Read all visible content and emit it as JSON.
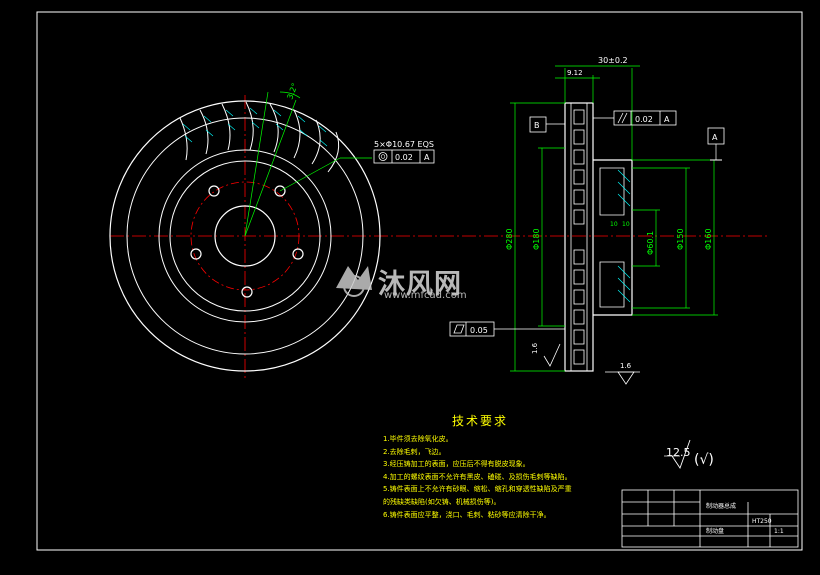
{
  "drawing": {
    "background": "#000000",
    "line_color": "#ffffff",
    "center_line_color": "#ff0000",
    "dim_color": "#00ff00",
    "text_color": "#ffff00"
  },
  "front_view": {
    "angle_label": "3.2°",
    "hole_callout": "5×Φ10.67 EQS",
    "position_tol": "0.02",
    "datum": "A"
  },
  "section_view": {
    "top_dim": "30±0.2",
    "thickness_dim": "9.12",
    "parallel_tol": "0.02",
    "parallel_datum": "A",
    "datum_b": "B",
    "datum_a": "A",
    "diameters": [
      "Φ280",
      "Φ180",
      "Φ60.1",
      "Φ150",
      "Φ160"
    ],
    "flatness_tol": "0.05",
    "roughness_left": "1.6",
    "roughness_right": "1.6",
    "small_dims": [
      "10",
      "10"
    ]
  },
  "tech_requirements": {
    "title": "技术要求",
    "notes": [
      "1.毕件须去除氧化皮。",
      "2.去除毛刺，飞边。",
      "3.经压铸加工的表面，应压后不得有脱皮现象。",
      "4.加工的螺纹表面不允许有黑皮、磕碰、及损伤毛刺等缺陷。",
      "5.铸件表面上不允许有砂眼、缩松、缩孔和穿透性缺陷及严重",
      "  的残缺类缺陷(如欠铸、机械损伤等)。",
      "6.铸件表面应平整，浇口、毛刺、粘砂等应清除干净。"
    ]
  },
  "roughness_general": {
    "value": "12.5",
    "paren": "(√)"
  },
  "title_block": {
    "name": "制动器总成",
    "part": "制动盘",
    "scale": "1:1",
    "material": "HT250"
  },
  "watermark": {
    "brand": "沐风网",
    "url": "www.mfcad.com"
  }
}
